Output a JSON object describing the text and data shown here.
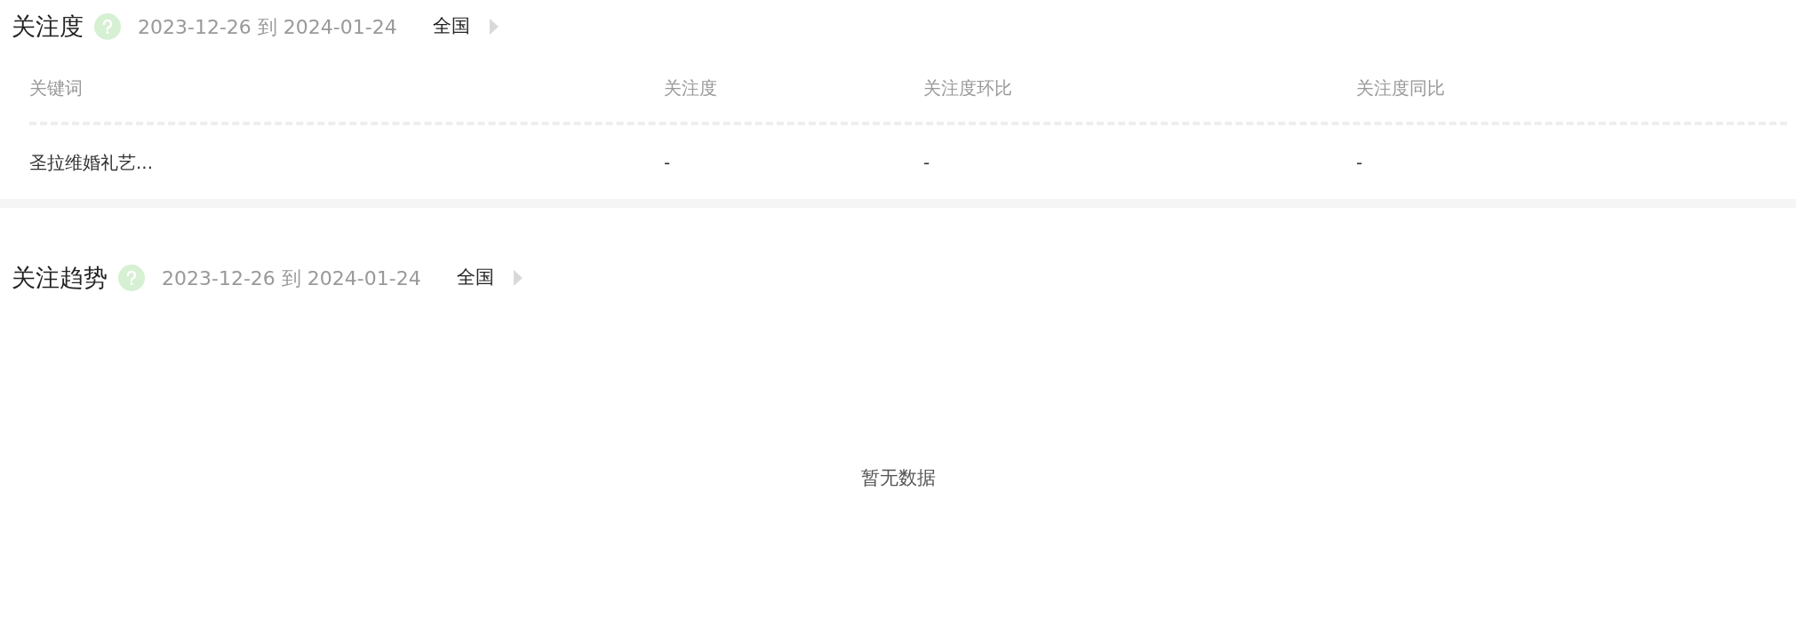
{
  "attention": {
    "title": "关注度",
    "date_range": "2023-12-26 到 2024-01-24",
    "region": "全国",
    "table": {
      "columns": [
        "关键词",
        "关注度",
        "关注度环比",
        "关注度同比"
      ],
      "rows": [
        [
          "圣拉维婚礼艺...",
          "-",
          "-",
          "-"
        ]
      ]
    }
  },
  "trend": {
    "title": "关注趋势",
    "date_range": "2023-12-26 到 2024-01-24",
    "region": "全国",
    "empty_text": "暂无数据"
  }
}
